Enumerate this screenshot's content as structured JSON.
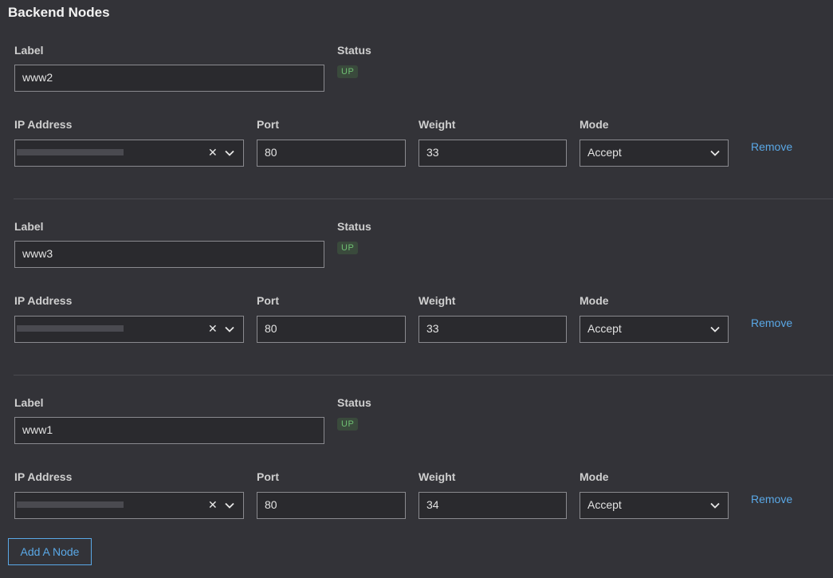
{
  "section_title": "Backend Nodes",
  "labels": {
    "label": "Label",
    "status": "Status",
    "ip": "IP Address",
    "port": "Port",
    "weight": "Weight",
    "mode": "Mode",
    "remove": "Remove"
  },
  "nodes": [
    {
      "label": "www2",
      "status": "UP",
      "port": "80",
      "weight": "33",
      "mode": "Accept"
    },
    {
      "label": "www3",
      "status": "UP",
      "port": "80",
      "weight": "33",
      "mode": "Accept"
    },
    {
      "label": "www1",
      "status": "UP",
      "port": "80",
      "weight": "34",
      "mode": "Accept"
    }
  ],
  "add_button": "Add A Node",
  "colors": {
    "accent": "#5aa8e6",
    "status_up": "#6fbf73",
    "background": "#333338"
  }
}
